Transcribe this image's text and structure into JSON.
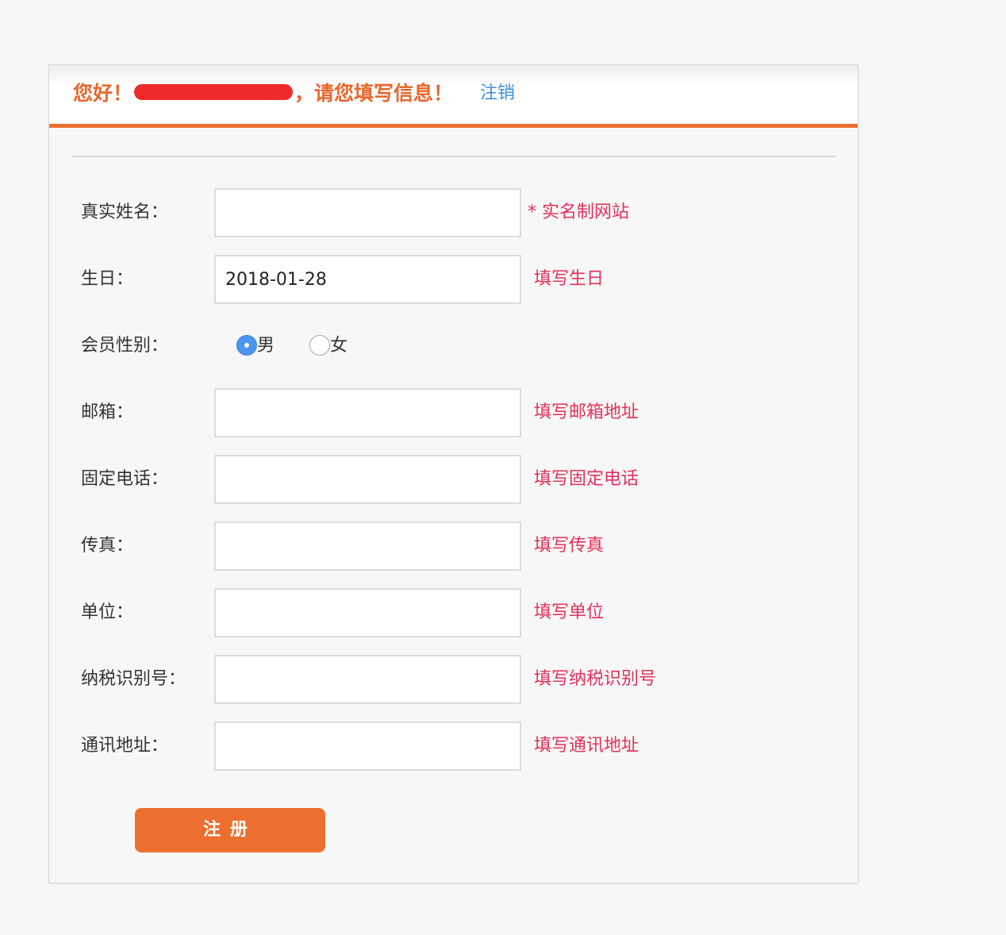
{
  "header": {
    "greeting_prefix": "您好！",
    "greeting_suffix": "，请您填写信息！",
    "logout_label": "注销"
  },
  "form": {
    "rows": [
      {
        "label": "真实姓名：",
        "value": "",
        "hint": "* 实名制网站"
      },
      {
        "label": "生日：",
        "value": "2018-01-28",
        "hint": "填写生日"
      },
      {
        "label": "会员性别：",
        "options": [
          "男",
          "女"
        ],
        "selected": "男"
      },
      {
        "label": "邮箱：",
        "value": "",
        "hint": "填写邮箱地址"
      },
      {
        "label": "固定电话：",
        "value": "",
        "hint": "填写固定电话"
      },
      {
        "label": "传真：",
        "value": "",
        "hint": "填写传真"
      },
      {
        "label": "单位：",
        "value": "",
        "hint": "填写单位"
      },
      {
        "label": "纳税识别号：",
        "value": "",
        "hint": "填写纳税识别号"
      },
      {
        "label": "通讯地址：",
        "value": "",
        "hint": "填写通讯地址"
      }
    ],
    "submit_label": "注册"
  },
  "colors": {
    "accent": "#ec6f2f",
    "hint": "#e5305a",
    "link": "#3a8fd8"
  }
}
